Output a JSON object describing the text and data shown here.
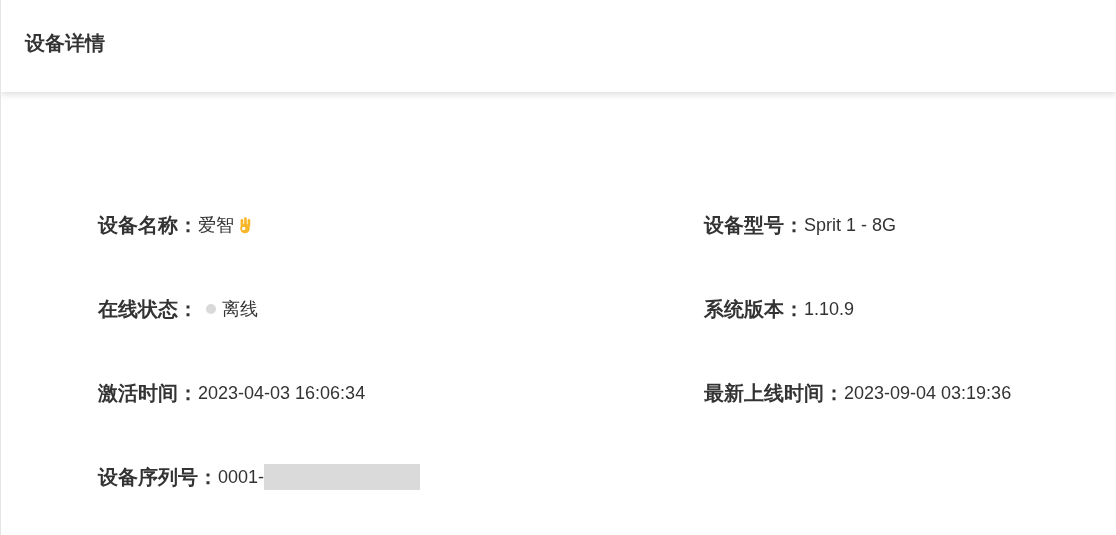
{
  "header": {
    "title": "设备详情"
  },
  "fields": [
    {
      "label": "设备名称：",
      "value": "爱智",
      "kind": "name"
    },
    {
      "label": "设备型号：",
      "value": "Sprit 1 - 8G",
      "kind": "text"
    },
    {
      "label": "在线状态：",
      "value": "离线",
      "kind": "status",
      "color": "#d9d9d9"
    },
    {
      "label": "系统版本：",
      "value": "1.10.9",
      "kind": "text"
    },
    {
      "label": "激活时间：",
      "value": "2023-04-03 16:06:34",
      "kind": "text"
    },
    {
      "label": "最新上线时间：",
      "value": "2023-09-04 03:19:36",
      "kind": "text"
    },
    {
      "label": "设备序列号：",
      "value": "0001-",
      "kind": "serial"
    }
  ]
}
